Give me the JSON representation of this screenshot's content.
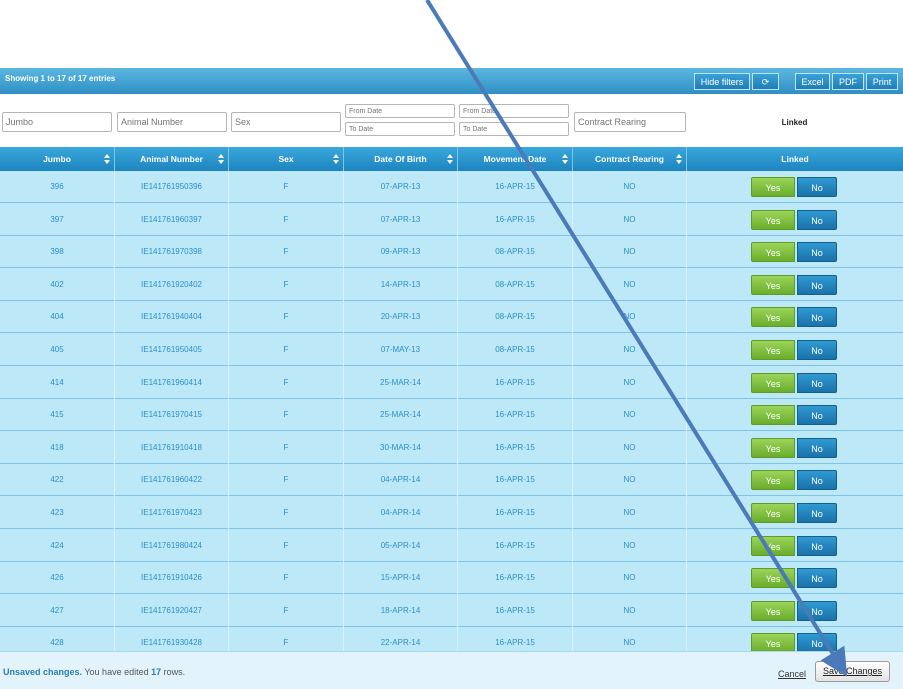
{
  "toolbar": {
    "entries_text": "Showing 1 to 17 of 17 entries",
    "hide_filters": "Hide filters",
    "refresh_glyph": "⟳",
    "excel": "Excel",
    "pdf": "PDF",
    "print": "Print"
  },
  "filters": {
    "jumbo_placeholder": "Jumbo",
    "animal_number_placeholder": "Animal Number",
    "sex_placeholder": "Sex",
    "from_date": "From Date",
    "to_date": "To Date",
    "contract_rearing_placeholder": "Contract Rearing",
    "linked_label": "Linked"
  },
  "columns": [
    "Jumbo",
    "Animal Number",
    "Sex",
    "Date Of Birth",
    "Movement Date",
    "Contract Rearing",
    "Linked"
  ],
  "rows": [
    {
      "jumbo": "396",
      "animal_number": "IE141761950396",
      "sex": "F",
      "dob": "07-APR-13",
      "movement": "16-APR-15",
      "contract": "NO"
    },
    {
      "jumbo": "397",
      "animal_number": "IE141761960397",
      "sex": "F",
      "dob": "07-APR-13",
      "movement": "16-APR-15",
      "contract": "NO"
    },
    {
      "jumbo": "398",
      "animal_number": "IE141761970398",
      "sex": "F",
      "dob": "09-APR-13",
      "movement": "08-APR-15",
      "contract": "NO"
    },
    {
      "jumbo": "402",
      "animal_number": "IE141761920402",
      "sex": "F",
      "dob": "14-APR-13",
      "movement": "08-APR-15",
      "contract": "NO"
    },
    {
      "jumbo": "404",
      "animal_number": "IE141761940404",
      "sex": "F",
      "dob": "20-APR-13",
      "movement": "08-APR-15",
      "contract": "NO"
    },
    {
      "jumbo": "405",
      "animal_number": "IE141761950405",
      "sex": "F",
      "dob": "07-MAY-13",
      "movement": "08-APR-15",
      "contract": "NO"
    },
    {
      "jumbo": "414",
      "animal_number": "IE141761960414",
      "sex": "F",
      "dob": "25-MAR-14",
      "movement": "16-APR-15",
      "contract": "NO"
    },
    {
      "jumbo": "415",
      "animal_number": "IE141761970415",
      "sex": "F",
      "dob": "25-MAR-14",
      "movement": "16-APR-15",
      "contract": "NO"
    },
    {
      "jumbo": "418",
      "animal_number": "IE141761910418",
      "sex": "F",
      "dob": "30-MAR-14",
      "movement": "16-APR-15",
      "contract": "NO"
    },
    {
      "jumbo": "422",
      "animal_number": "IE141761960422",
      "sex": "F",
      "dob": "04-APR-14",
      "movement": "16-APR-15",
      "contract": "NO"
    },
    {
      "jumbo": "423",
      "animal_number": "IE141761970423",
      "sex": "F",
      "dob": "04-APR-14",
      "movement": "16-APR-15",
      "contract": "NO"
    },
    {
      "jumbo": "424",
      "animal_number": "IE141761980424",
      "sex": "F",
      "dob": "05-APR-14",
      "movement": "16-APR-15",
      "contract": "NO"
    },
    {
      "jumbo": "426",
      "animal_number": "IE141761910426",
      "sex": "F",
      "dob": "15-APR-14",
      "movement": "16-APR-15",
      "contract": "NO"
    },
    {
      "jumbo": "427",
      "animal_number": "IE141761920427",
      "sex": "F",
      "dob": "18-APR-14",
      "movement": "16-APR-15",
      "contract": "NO"
    },
    {
      "jumbo": "428",
      "animal_number": "IE141761930428",
      "sex": "F",
      "dob": "22-APR-14",
      "movement": "16-APR-15",
      "contract": "NO"
    }
  ],
  "linked_buttons": {
    "yes": "Yes",
    "no": "No"
  },
  "footer": {
    "unsaved_label": "Unsaved changes.",
    "edited_prefix": " You have edited ",
    "edited_count": "17",
    "edited_suffix": " rows.",
    "cancel": "Cancel",
    "save_changes": "Save Changes"
  },
  "colors": {
    "header_blue": "#1c84bf",
    "row_bg": "#bde8f8",
    "cell_text": "#2a8fc6",
    "yes_green": "#6aad2c",
    "no_blue": "#1a72a8",
    "annotation_arrow": "#4a7ab8"
  }
}
